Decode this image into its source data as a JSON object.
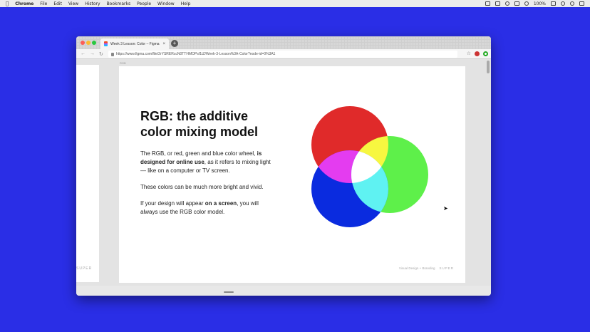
{
  "menubar": {
    "app_name": "Chrome",
    "items": [
      "File",
      "Edit",
      "View",
      "History",
      "Bookmarks",
      "People",
      "Window",
      "Help"
    ],
    "battery": "100%",
    "icons": [
      "apple-icon",
      "spotify-icon",
      "dropbox-icon",
      "wifi-icon",
      "airplay-icon",
      "volume-icon",
      "battery-icon",
      "search-icon",
      "user-icon",
      "menu-icon"
    ]
  },
  "browser": {
    "tab_title": "Week 3 Lesson: Color – Figma",
    "tab_close": "×",
    "new_tab": "+",
    "url": "https://www.figma.com/file/2rYSRERccN0TTHMOPsf1tZ/Week-3-Lesson%3A-Color?node-id=0%3A1",
    "star": "☆"
  },
  "figma": {
    "frame_label": "RGB",
    "left_logo": "SUPER"
  },
  "slide": {
    "heading": "RGB: the additive color mixing model",
    "p1_pre": "The RGB, or red, green and blue color wheel, ",
    "p1_bold": "is designed for online use",
    "p1_post": ", as it refers to mixing light — like on a computer or TV screen.",
    "p2": "These colors can be much more bright and vivid.",
    "p3_pre": "If your design will appear ",
    "p3_bold": "on a screen",
    "p3_post": ", you will always use the RGB color model.",
    "footer_label": "Visual Design + Branding",
    "footer_brand": "SUPER"
  },
  "colors": {
    "background": "#2a2ee6",
    "red": "#e02a2a",
    "green": "#5ef04a",
    "blue": "#0a2bdf",
    "yellow": "#f7f740",
    "magenta": "#e43cf0",
    "cyan": "#5ff2f2",
    "white": "#ffffff"
  }
}
